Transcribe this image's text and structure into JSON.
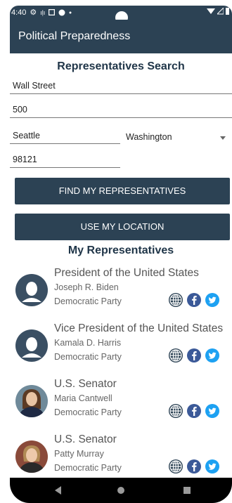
{
  "status": {
    "time": "4:40"
  },
  "app": {
    "title": "Political Preparedness"
  },
  "search": {
    "title": "Representatives Search",
    "address_line1": "Wall Street",
    "address_line2": "500",
    "city": "Seattle",
    "state": "Washington",
    "zip": "98121",
    "find_button": "FIND MY REPRESENTATIVES",
    "location_button": "USE MY LOCATION"
  },
  "representatives": {
    "title": "My Representatives",
    "items": [
      {
        "office": "President of the United States",
        "name": "Joseph R. Biden",
        "party": "Democratic Party"
      },
      {
        "office": "Vice President of the United States",
        "name": "Kamala D. Harris",
        "party": "Democratic Party"
      },
      {
        "office": "U.S. Senator",
        "name": "Maria Cantwell",
        "party": "Democratic Party"
      },
      {
        "office": "U.S. Senator",
        "name": "Patty Murray",
        "party": "Democratic Party"
      }
    ]
  },
  "colors": {
    "primary": "#2c4254",
    "facebook": "#3b5998",
    "twitter": "#1da1f2"
  }
}
